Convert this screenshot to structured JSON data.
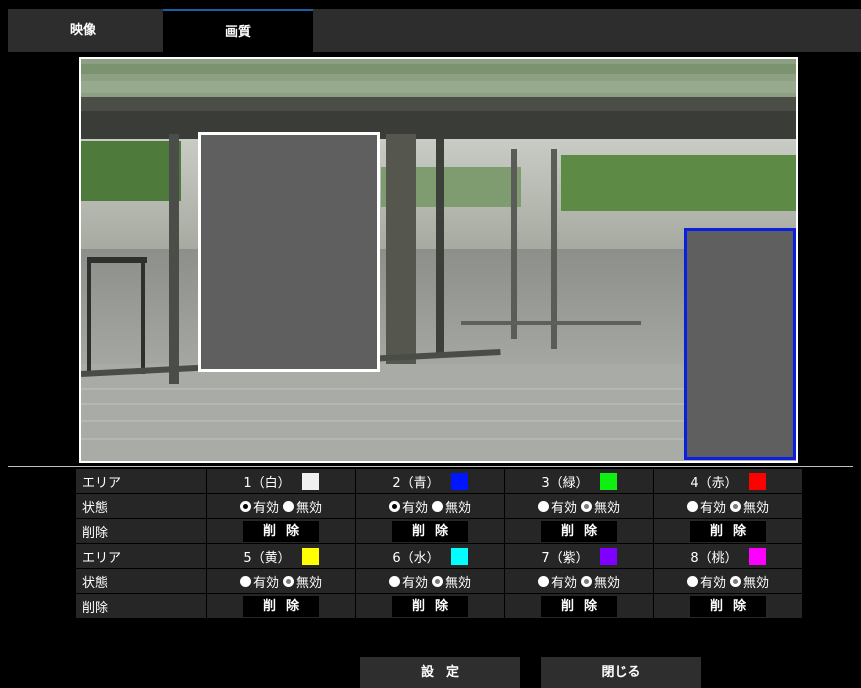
{
  "tabs": [
    {
      "label": "映像"
    },
    {
      "label": "画質"
    }
  ],
  "table": {
    "area_label": "エリア",
    "status_label": "状態",
    "delete_label": "削除",
    "delete_button": "削除",
    "enabled_label": "有効",
    "disabled_label": "無効",
    "groups": [
      {
        "areas": [
          {
            "name": "1（白）",
            "color": "#f0f0f0",
            "status": "enabled"
          },
          {
            "name": "2（青）",
            "color": "#0016ff",
            "status": "enabled"
          },
          {
            "name": "3（緑）",
            "color": "#0ff012",
            "status": "disabled"
          },
          {
            "name": "4（赤）",
            "color": "#ff0000",
            "status": "disabled"
          }
        ]
      },
      {
        "areas": [
          {
            "name": "5（黄）",
            "color": "#ffff00",
            "status": "disabled"
          },
          {
            "name": "6（水）",
            "color": "#00ffff",
            "status": "disabled"
          },
          {
            "name": "7（紫）",
            "color": "#8000ff",
            "status": "disabled"
          },
          {
            "name": "8（桃）",
            "color": "#ff00ff",
            "status": "disabled"
          }
        ]
      }
    ]
  },
  "buttons": {
    "set": "設定",
    "close": "閉じる"
  },
  "mask_colors": {
    "area1": "#ffffff",
    "area2": "#0a1fe0"
  }
}
